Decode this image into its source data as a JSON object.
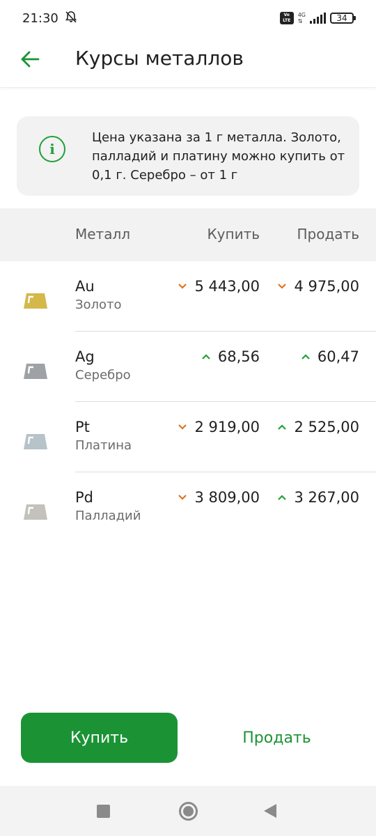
{
  "status_bar": {
    "time": "21:30",
    "network": "4G",
    "volte": "Vo LTE",
    "battery": "34"
  },
  "header": {
    "title": "Курсы металлов"
  },
  "info": {
    "text": "Цена указана за 1 г металла. Золото, палладий и платину можно купить от 0,1 г. Серебро – от 1 г"
  },
  "table": {
    "columns": {
      "metal": "Металл",
      "buy": "Купить",
      "sell": "Продать"
    },
    "rows": [
      {
        "symbol": "Au",
        "name": "Золото",
        "buy": "5 443,00",
        "buy_trend": "down",
        "sell": "4 975,00",
        "sell_trend": "down",
        "bar_color": "#d4b84a"
      },
      {
        "symbol": "Ag",
        "name": "Серебро",
        "buy": "68,56",
        "buy_trend": "up",
        "sell": "60,47",
        "sell_trend": "up",
        "bar_color": "#9ea2a6"
      },
      {
        "symbol": "Pt",
        "name": "Платина",
        "buy": "2 919,00",
        "buy_trend": "down",
        "sell": "2 525,00",
        "sell_trend": "up",
        "bar_color": "#b6c3c9"
      },
      {
        "symbol": "Pd",
        "name": "Палладий",
        "buy": "3 809,00",
        "buy_trend": "down",
        "sell": "3 267,00",
        "sell_trend": "up",
        "bar_color": "#c3c1bb"
      }
    ]
  },
  "actions": {
    "buy_label": "Купить",
    "sell_label": "Продать"
  },
  "colors": {
    "accent": "#1b9335",
    "trend_up": "#21a038",
    "trend_down": "#e0721e"
  },
  "icons": {
    "back": "arrow-left-icon",
    "info": "info-icon",
    "bar": "metal-bar-icon"
  }
}
